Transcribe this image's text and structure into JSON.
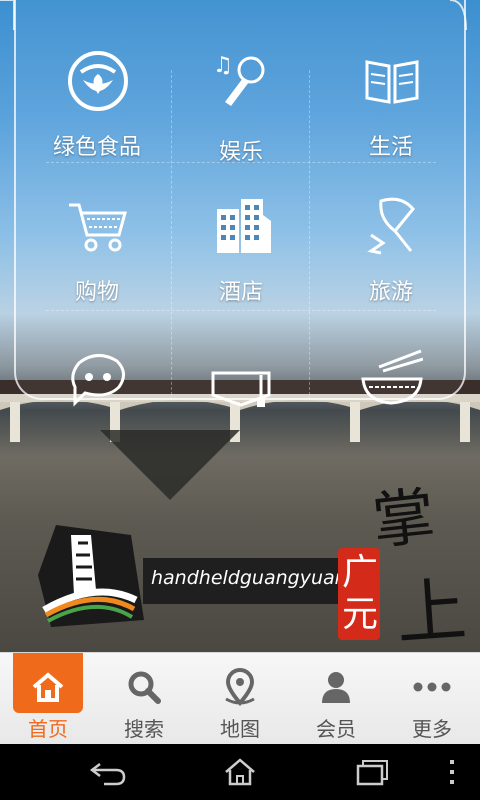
{
  "brand": {
    "latin_name": "handheldguangyuan",
    "logo_chars": [
      "掌",
      "上",
      "广",
      "元"
    ]
  },
  "tiles": [
    {
      "label": "绿色食品",
      "icon": "leaf-food-icon"
    },
    {
      "label": "娱乐",
      "icon": "microphone-music-icon"
    },
    {
      "label": "生活",
      "icon": "open-book-icon"
    },
    {
      "label": "购物",
      "icon": "shopping-cart-icon"
    },
    {
      "label": "酒店",
      "icon": "hotel-building-icon"
    },
    {
      "label": "旅游",
      "icon": "travel-fan-icon"
    },
    {
      "label": "",
      "icon": "chat-bubble-icon"
    },
    {
      "label": "",
      "icon": "graduation-cap-icon"
    },
    {
      "label": "",
      "icon": "noodle-bowl-icon"
    }
  ],
  "tabbar": {
    "accent_color": "#f06a1c",
    "active_index": 0,
    "items": [
      {
        "label": "首页",
        "icon": "home-icon"
      },
      {
        "label": "搜索",
        "icon": "search-icon"
      },
      {
        "label": "地图",
        "icon": "map-pin-icon"
      },
      {
        "label": "会员",
        "icon": "user-icon"
      },
      {
        "label": "更多",
        "icon": "more-dots-icon"
      }
    ]
  },
  "system_nav": {
    "buttons": [
      "back-icon",
      "home-icon",
      "recent-apps-icon",
      "menu-dots-icon"
    ]
  }
}
